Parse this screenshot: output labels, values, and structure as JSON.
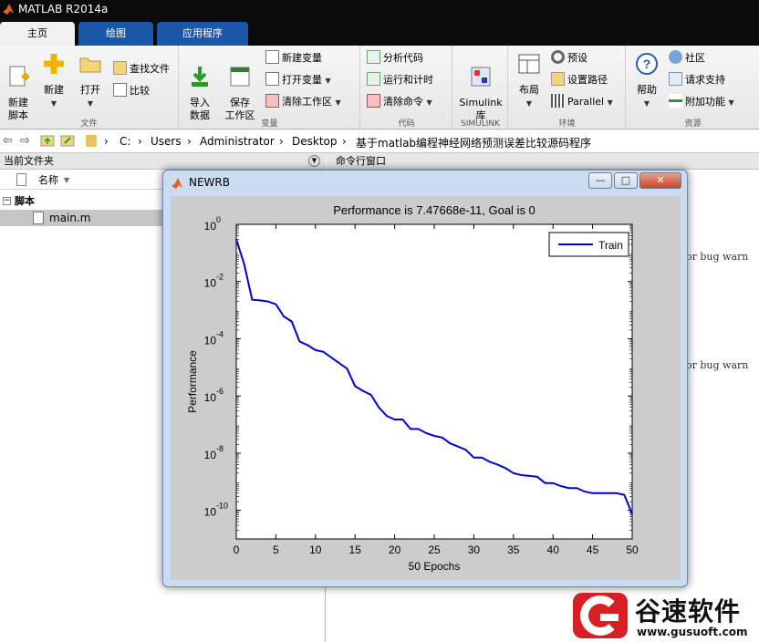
{
  "app": {
    "title": "MATLAB R2014a"
  },
  "tabs": [
    {
      "label": "主页"
    },
    {
      "label": "绘图"
    },
    {
      "label": "应用程序"
    }
  ],
  "ribbon": {
    "file": {
      "label": "文件",
      "new_script": "新建\n脚本",
      "new": "新建",
      "open": "打开",
      "find_files": "查找文件",
      "compare": "比较"
    },
    "variable": {
      "label": "变量",
      "import": "导入\n数据",
      "save_ws": "保存\n工作区",
      "new_var": "新建变量",
      "open_var": "打开变量",
      "clear_ws": "清除工作区"
    },
    "code": {
      "label": "代码",
      "analyze": "分析代码",
      "run_time": "运行和计时",
      "clear_cmd": "清除命令"
    },
    "simulink": {
      "label": "SIMULINK",
      "lib": "Simulink\n库"
    },
    "env": {
      "label": "环境",
      "layout": "布局",
      "prefs": "预设",
      "set_path": "设置路径",
      "parallel": "Parallel"
    },
    "resources": {
      "label": "资源",
      "help": "帮助",
      "community": "社区",
      "request_support": "请求支持",
      "addons": "附加功能"
    }
  },
  "address": {
    "path": [
      "C:",
      "Users",
      "Administrator",
      "Desktop",
      "基于matlab编程神经网络预测误差比较源码程序"
    ]
  },
  "current_folder": {
    "header": "当前文件夹",
    "col_name": "名称",
    "group": "脚本",
    "file": "main.m"
  },
  "command_window": {
    "header": "命令行窗口",
    "lines": [
      "or bug warn",
      "or bug warn"
    ]
  },
  "figure": {
    "title": "NEWRB",
    "buttons": {
      "min": "—",
      "max": "□",
      "close": "✕"
    }
  },
  "chart_data": {
    "type": "line",
    "title": "Performance is 7.47668e-11, Goal is 0",
    "xlabel": "50 Epochs",
    "ylabel": "Performance",
    "xlim": [
      0,
      50
    ],
    "ylim": [
      1e-11,
      1
    ],
    "yscale": "log",
    "xticks": [
      "0",
      "5",
      "10",
      "15",
      "20",
      "25",
      "30",
      "35",
      "40",
      "45",
      "50"
    ],
    "yticks": [
      "10",
      "10",
      "10",
      "10",
      "10",
      "10"
    ],
    "ytick_exponents": [
      "0",
      "-2",
      "-4",
      "-6",
      "-8",
      "-10"
    ],
    "legend_position": "top-right",
    "series": [
      {
        "name": "Train",
        "color": "#0000cc",
        "x": [
          0,
          1,
          2,
          3,
          4,
          5,
          6,
          7,
          8,
          9,
          10,
          11,
          12,
          13,
          14,
          15,
          16,
          17,
          18,
          19,
          20,
          21,
          22,
          23,
          24,
          25,
          26,
          27,
          28,
          29,
          30,
          31,
          32,
          33,
          34,
          35,
          36,
          37,
          38,
          39,
          40,
          41,
          42,
          43,
          44,
          45,
          46,
          47,
          48,
          49,
          50
        ],
        "y": [
          0.3,
          0.04,
          0.0023,
          0.0022,
          0.002,
          0.0016,
          0.0006,
          0.0004,
          8e-05,
          6e-05,
          4e-05,
          3.5e-05,
          2.2e-05,
          1.4e-05,
          9e-06,
          2.2e-06,
          1.5e-06,
          1.1e-06,
          4e-07,
          2e-07,
          1.5e-07,
          1.5e-07,
          7e-08,
          7e-08,
          5e-08,
          4e-08,
          3.5e-08,
          2.2e-08,
          1.7e-08,
          1.3e-08,
          7e-09,
          7e-09,
          5e-09,
          4e-09,
          3e-09,
          2e-09,
          1.7e-09,
          1.6e-09,
          1.5e-09,
          9e-10,
          9e-10,
          7e-10,
          6e-10,
          6e-10,
          4.5e-10,
          4e-10,
          4e-10,
          4e-10,
          4e-10,
          3.5e-10,
          7.48e-11
        ]
      }
    ]
  },
  "watermark": {
    "brand": "谷速软件",
    "url": "www.gusuoft.com"
  },
  "colors": {
    "accent": "#1b57a8",
    "line": "#0000cc",
    "close": "#c4452b"
  }
}
